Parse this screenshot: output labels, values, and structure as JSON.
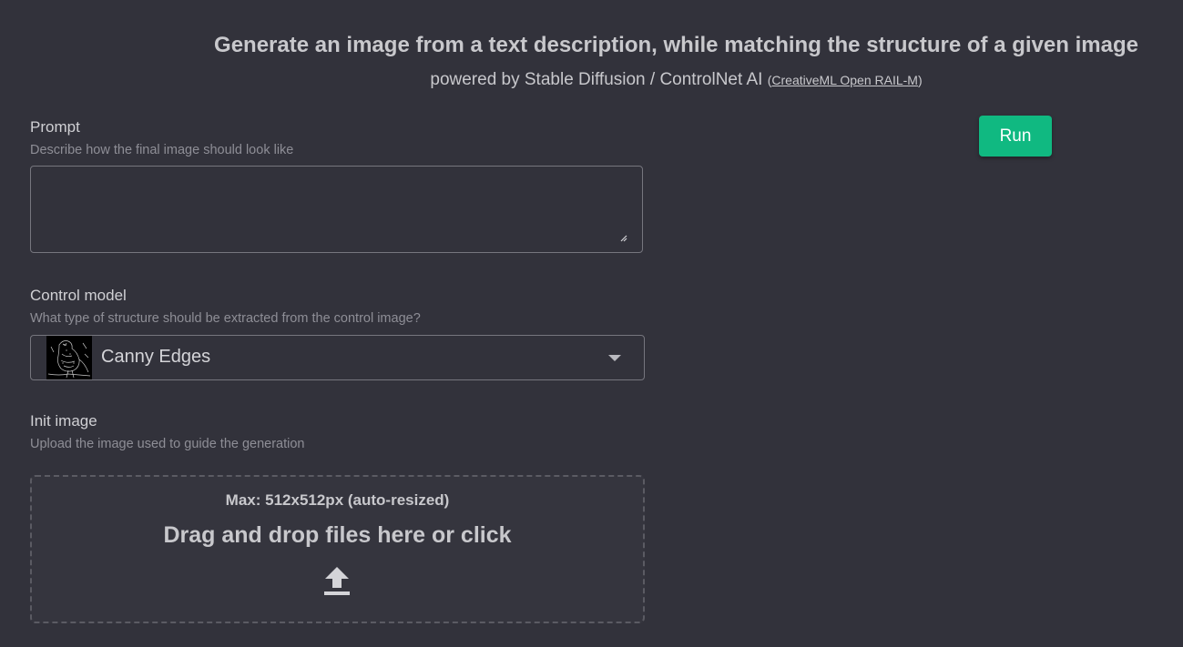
{
  "header": {
    "title": "Generate an image from a text description, while matching the structure of a given image",
    "subtitle": "powered by Stable Diffusion / ControlNet AI",
    "paren_open": "(",
    "license_link": "CreativeML Open RAIL-M",
    "paren_close": ")"
  },
  "run_button": {
    "label": "Run",
    "color": "#10b981"
  },
  "prompt": {
    "label": "Prompt",
    "help": "Describe how the final image should look like",
    "value": ""
  },
  "control_model": {
    "label": "Control model",
    "help": "What type of structure should be extracted from the control image?",
    "selected": "Canny Edges",
    "icon": "chevron-down-icon"
  },
  "init_image": {
    "label": "Init image",
    "help": "Upload the image used to guide the generation",
    "max_note": "Max: 512x512px (auto-resized)",
    "drop_text": "Drag and drop files here or click",
    "icon": "upload-icon"
  },
  "colors": {
    "background": "#32323b",
    "accent": "#10b981",
    "border": "#76767e"
  }
}
